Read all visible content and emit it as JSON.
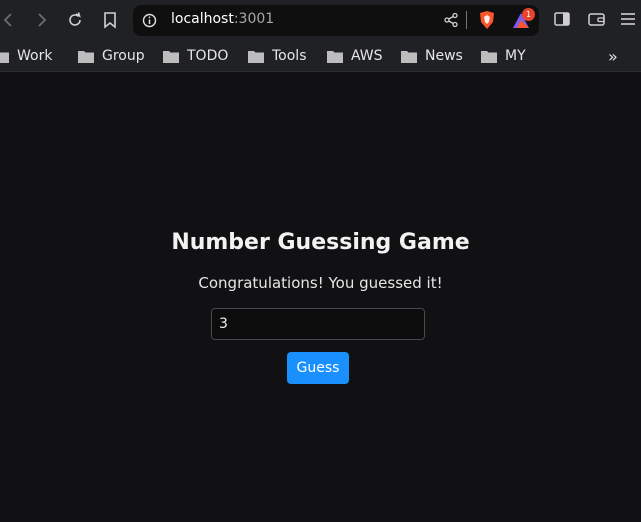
{
  "browser": {
    "url_host": "localhost",
    "url_port": ":3001",
    "notification_count": "1",
    "icons": {
      "back": "back-arrow-icon",
      "forward": "forward-arrow-icon",
      "reload": "reload-icon",
      "bookmark": "bookmark-icon",
      "site_info": "info-icon",
      "share": "share-icon",
      "brave_shield": "brave-shield-icon",
      "brave_rewards": "brave-rewards-icon",
      "sidebar": "sidebar-icon",
      "wallet": "wallet-icon",
      "menu": "menu-icon"
    }
  },
  "bookmarks": {
    "items": [
      {
        "label": "Work"
      },
      {
        "label": "Group"
      },
      {
        "label": "TODO"
      },
      {
        "label": "Tools"
      },
      {
        "label": "AWS"
      },
      {
        "label": "News"
      },
      {
        "label": "MY"
      }
    ],
    "overflow": "»"
  },
  "game": {
    "title": "Number Guessing Game",
    "message": "Congratulations! You guessed it!",
    "input_value": "3",
    "button_label": "Guess"
  },
  "colors": {
    "background": "#111113",
    "toolbar": "#202124",
    "button": "#1a90ff",
    "brave_orange": "#fb542b"
  }
}
